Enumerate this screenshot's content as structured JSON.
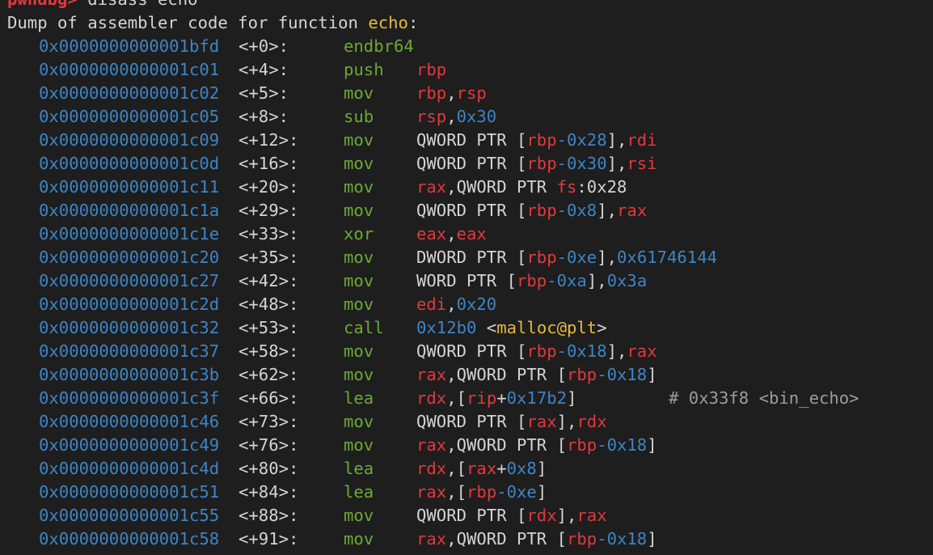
{
  "prompt": {
    "name": "pwndbg>",
    "command": " disass echo"
  },
  "header": {
    "prefix": "Dump of assembler code for function ",
    "function": "echo",
    "suffix": ":"
  },
  "instructions": [
    {
      "addr": "0x0000000000001bfd",
      "offset": "<+0>:",
      "mnem": "endbr64",
      "ops": []
    },
    {
      "addr": "0x0000000000001c01",
      "offset": "<+4>:",
      "mnem": "push",
      "ops": [
        [
          "reg",
          "rbp"
        ]
      ]
    },
    {
      "addr": "0x0000000000001c02",
      "offset": "<+5>:",
      "mnem": "mov",
      "ops": [
        [
          "reg",
          "rbp"
        ],
        [
          "plain",
          ","
        ],
        [
          "reg",
          "rsp"
        ]
      ]
    },
    {
      "addr": "0x0000000000001c05",
      "offset": "<+8>:",
      "mnem": "sub",
      "ops": [
        [
          "reg",
          "rsp"
        ],
        [
          "plain",
          ","
        ],
        [
          "num",
          "0x30"
        ]
      ]
    },
    {
      "addr": "0x0000000000001c09",
      "offset": "<+12>:",
      "mnem": "mov",
      "ops": [
        [
          "plain",
          "QWORD PTR ["
        ],
        [
          "reg",
          "rbp"
        ],
        [
          "num",
          "-0x28"
        ],
        [
          "plain",
          "],"
        ],
        [
          "reg",
          "rdi"
        ]
      ]
    },
    {
      "addr": "0x0000000000001c0d",
      "offset": "<+16>:",
      "mnem": "mov",
      "ops": [
        [
          "plain",
          "QWORD PTR ["
        ],
        [
          "reg",
          "rbp"
        ],
        [
          "num",
          "-0x30"
        ],
        [
          "plain",
          "],"
        ],
        [
          "reg",
          "rsi"
        ]
      ]
    },
    {
      "addr": "0x0000000000001c11",
      "offset": "<+20>:",
      "mnem": "mov",
      "ops": [
        [
          "reg",
          "rax"
        ],
        [
          "plain",
          ",QWORD PTR "
        ],
        [
          "reg",
          "fs"
        ],
        [
          "plain",
          ":0x28"
        ]
      ]
    },
    {
      "addr": "0x0000000000001c1a",
      "offset": "<+29>:",
      "mnem": "mov",
      "ops": [
        [
          "plain",
          "QWORD PTR ["
        ],
        [
          "reg",
          "rbp"
        ],
        [
          "num",
          "-0x8"
        ],
        [
          "plain",
          "],"
        ],
        [
          "reg",
          "rax"
        ]
      ]
    },
    {
      "addr": "0x0000000000001c1e",
      "offset": "<+33>:",
      "mnem": "xor",
      "ops": [
        [
          "reg",
          "eax"
        ],
        [
          "plain",
          ","
        ],
        [
          "reg",
          "eax"
        ]
      ]
    },
    {
      "addr": "0x0000000000001c20",
      "offset": "<+35>:",
      "mnem": "mov",
      "ops": [
        [
          "plain",
          "DWORD PTR ["
        ],
        [
          "reg",
          "rbp"
        ],
        [
          "num",
          "-0xe"
        ],
        [
          "plain",
          "],"
        ],
        [
          "num",
          "0x61746144"
        ]
      ]
    },
    {
      "addr": "0x0000000000001c27",
      "offset": "<+42>:",
      "mnem": "mov",
      "ops": [
        [
          "plain",
          "WORD PTR ["
        ],
        [
          "reg",
          "rbp"
        ],
        [
          "num",
          "-0xa"
        ],
        [
          "plain",
          "],"
        ],
        [
          "num",
          "0x3a"
        ]
      ]
    },
    {
      "addr": "0x0000000000001c2d",
      "offset": "<+48>:",
      "mnem": "mov",
      "ops": [
        [
          "reg",
          "edi"
        ],
        [
          "plain",
          ","
        ],
        [
          "num",
          "0x20"
        ]
      ]
    },
    {
      "addr": "0x0000000000001c32",
      "offset": "<+53>:",
      "mnem": "call",
      "ops": [
        [
          "num",
          "0x12b0"
        ],
        [
          "plain",
          " <"
        ],
        [
          "sym",
          "malloc@plt"
        ],
        [
          "plain",
          ">"
        ]
      ]
    },
    {
      "addr": "0x0000000000001c37",
      "offset": "<+58>:",
      "mnem": "mov",
      "ops": [
        [
          "plain",
          "QWORD PTR ["
        ],
        [
          "reg",
          "rbp"
        ],
        [
          "num",
          "-0x18"
        ],
        [
          "plain",
          "],"
        ],
        [
          "reg",
          "rax"
        ]
      ]
    },
    {
      "addr": "0x0000000000001c3b",
      "offset": "<+62>:",
      "mnem": "mov",
      "ops": [
        [
          "reg",
          "rax"
        ],
        [
          "plain",
          ",QWORD PTR ["
        ],
        [
          "reg",
          "rbp"
        ],
        [
          "num",
          "-0x18"
        ],
        [
          "plain",
          "]"
        ]
      ]
    },
    {
      "addr": "0x0000000000001c3f",
      "offset": "<+66>:",
      "mnem": "lea",
      "ops": [
        [
          "reg",
          "rdx"
        ],
        [
          "plain",
          ",["
        ],
        [
          "reg",
          "rip"
        ],
        [
          "plain",
          "+"
        ],
        [
          "num",
          "0x17b2"
        ],
        [
          "plain",
          "]"
        ]
      ],
      "comment": "# 0x33f8 <bin_echo>"
    },
    {
      "addr": "0x0000000000001c46",
      "offset": "<+73>:",
      "mnem": "mov",
      "ops": [
        [
          "plain",
          "QWORD PTR ["
        ],
        [
          "reg",
          "rax"
        ],
        [
          "plain",
          "],"
        ],
        [
          "reg",
          "rdx"
        ]
      ]
    },
    {
      "addr": "0x0000000000001c49",
      "offset": "<+76>:",
      "mnem": "mov",
      "ops": [
        [
          "reg",
          "rax"
        ],
        [
          "plain",
          ",QWORD PTR ["
        ],
        [
          "reg",
          "rbp"
        ],
        [
          "num",
          "-0x18"
        ],
        [
          "plain",
          "]"
        ]
      ]
    },
    {
      "addr": "0x0000000000001c4d",
      "offset": "<+80>:",
      "mnem": "lea",
      "ops": [
        [
          "reg",
          "rdx"
        ],
        [
          "plain",
          ",["
        ],
        [
          "reg",
          "rax"
        ],
        [
          "plain",
          "+"
        ],
        [
          "num",
          "0x8"
        ],
        [
          "plain",
          "]"
        ]
      ]
    },
    {
      "addr": "0x0000000000001c51",
      "offset": "<+84>:",
      "mnem": "lea",
      "ops": [
        [
          "reg",
          "rax"
        ],
        [
          "plain",
          ",["
        ],
        [
          "reg",
          "rbp"
        ],
        [
          "num",
          "-0xe"
        ],
        [
          "plain",
          "]"
        ]
      ]
    },
    {
      "addr": "0x0000000000001c55",
      "offset": "<+88>:",
      "mnem": "mov",
      "ops": [
        [
          "plain",
          "QWORD PTR ["
        ],
        [
          "reg",
          "rdx"
        ],
        [
          "plain",
          "],"
        ],
        [
          "reg",
          "rax"
        ]
      ]
    },
    {
      "addr": "0x0000000000001c58",
      "offset": "<+91>:",
      "mnem": "mov",
      "ops": [
        [
          "reg",
          "rax"
        ],
        [
          "plain",
          ",QWORD PTR ["
        ],
        [
          "reg",
          "rbp"
        ],
        [
          "num",
          "-0x18"
        ],
        [
          "plain",
          "]"
        ]
      ]
    }
  ],
  "colors": {
    "background": "#1e1e1e",
    "prompt": "#e0393e",
    "address": "#3d85c6",
    "mnemonic": "#6aaa32",
    "register": "#e0393e",
    "number": "#3d85c6",
    "symbol": "#e5b93c",
    "comment": "#9c9c9c",
    "text": "#d4d4d4"
  }
}
